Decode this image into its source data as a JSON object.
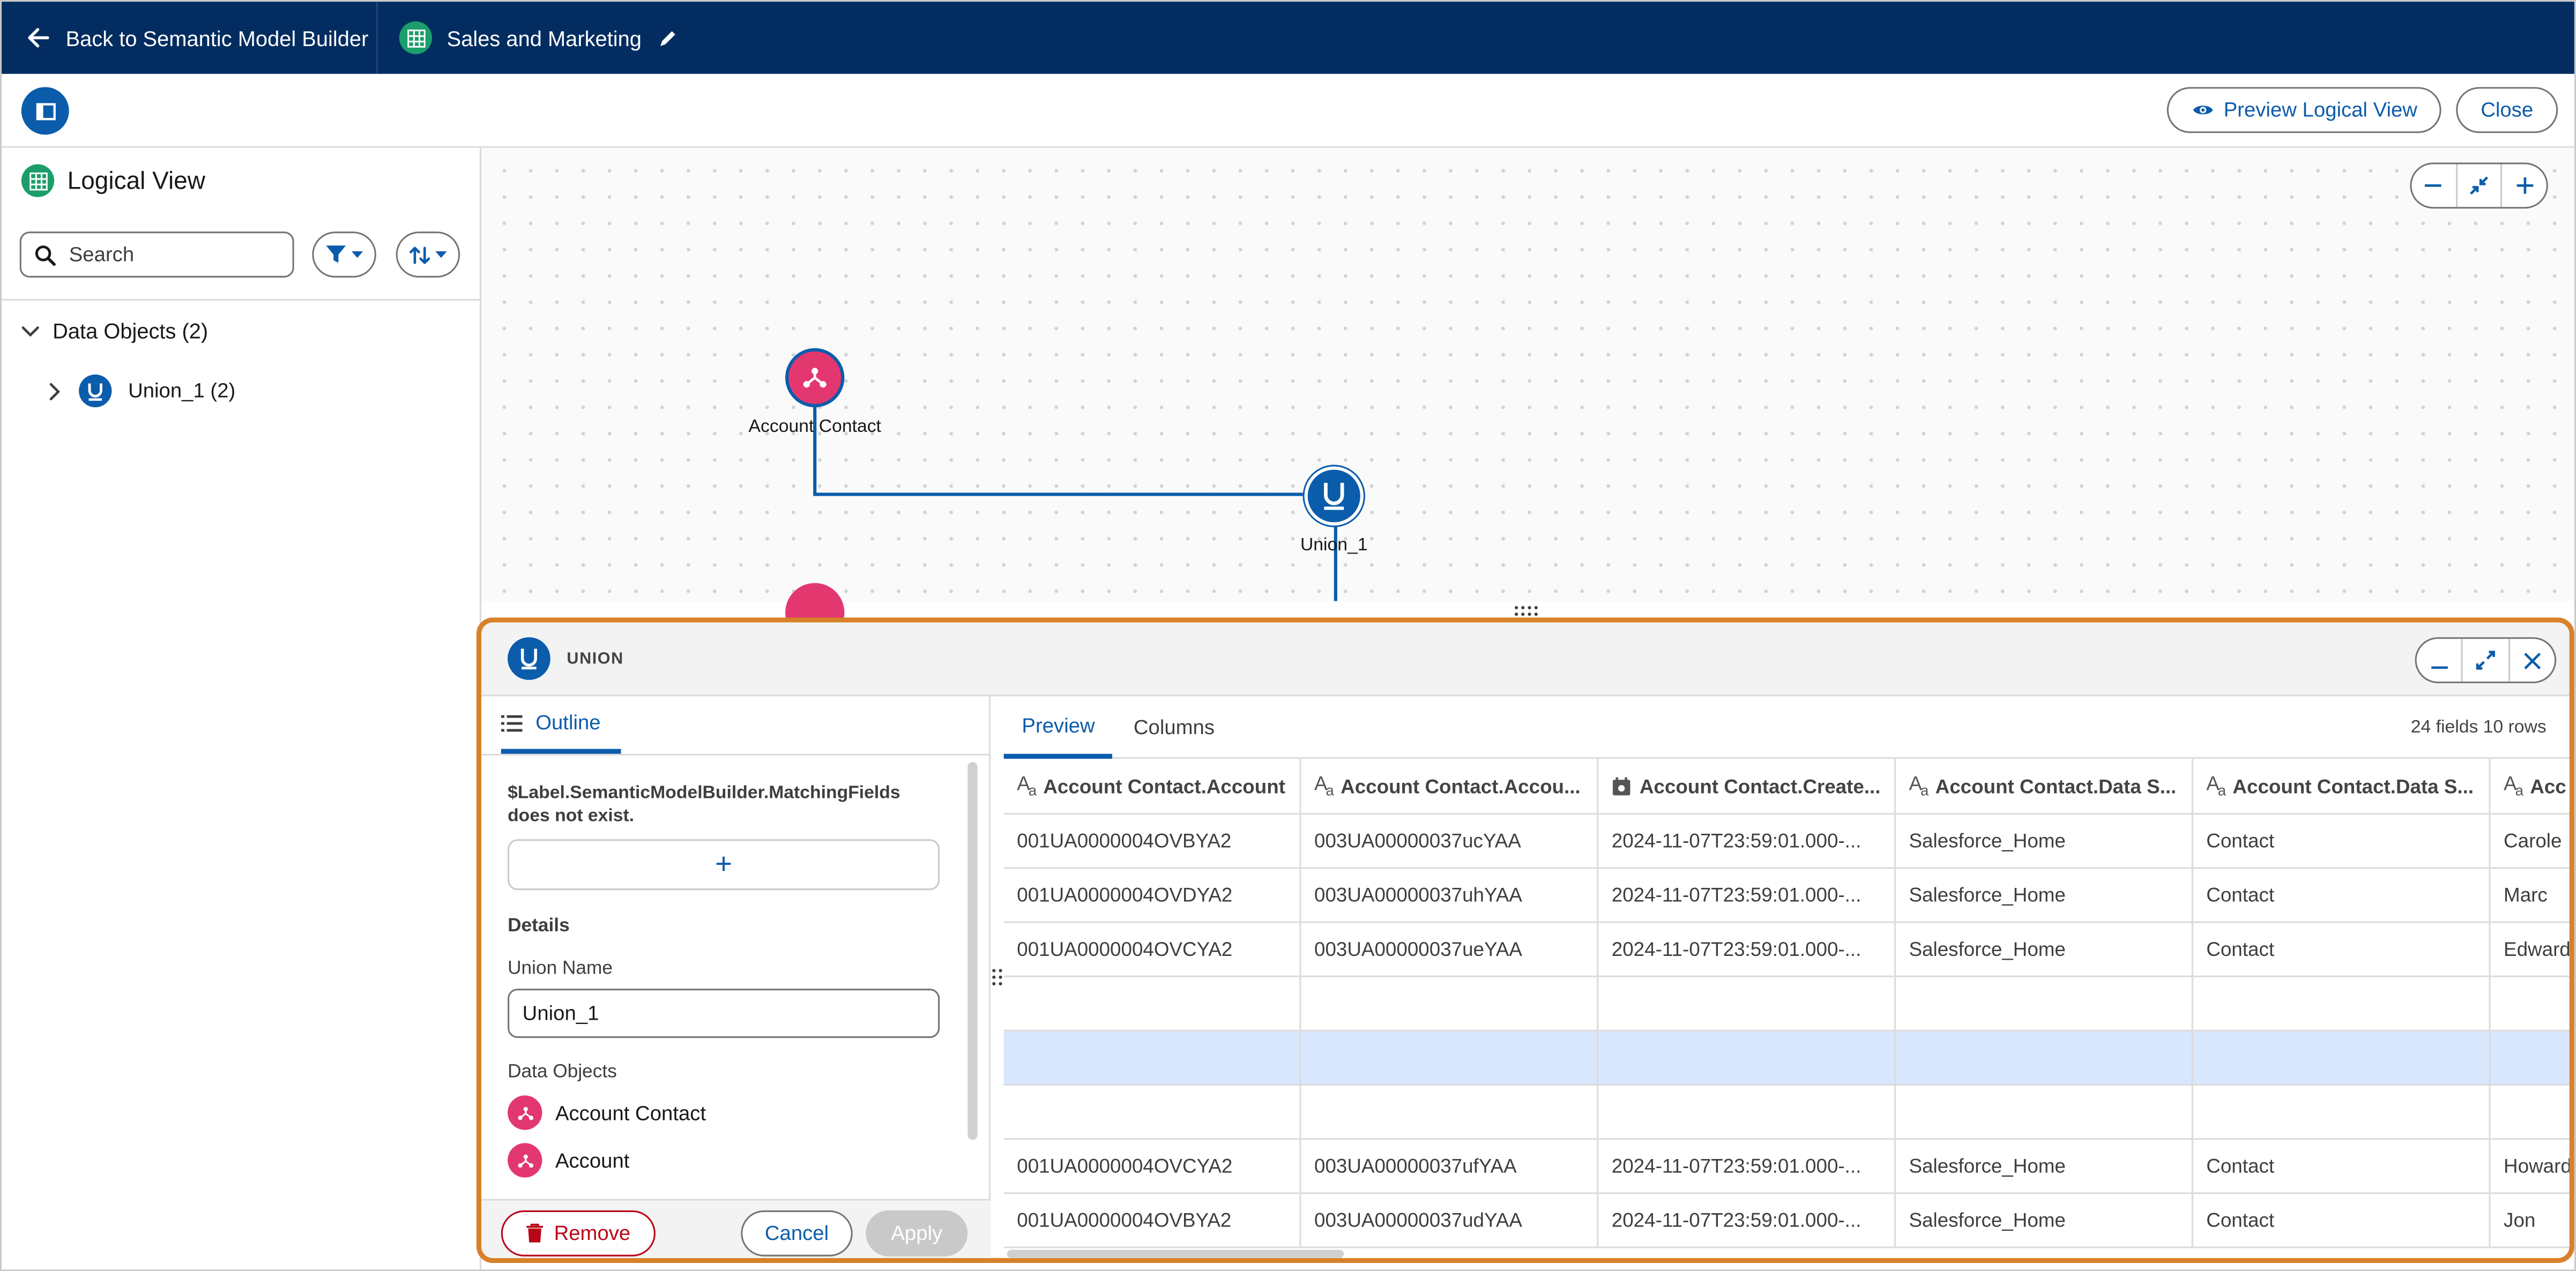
{
  "topnav": {
    "back_label": "Back to Semantic Model Builder",
    "model_name": "Sales and Marketing"
  },
  "toolbar": {
    "preview_label": "Preview Logical View",
    "close_label": "Close"
  },
  "left_panel": {
    "title": "Logical View",
    "search_placeholder": "Search",
    "tree": {
      "group_label": "Data Objects (2)",
      "item_label": "Union_1 (2)"
    }
  },
  "canvas": {
    "nodes": {
      "account_contact": "Account Contact",
      "union": "Union_1"
    }
  },
  "bottom_panel": {
    "title": "UNION",
    "outline": {
      "tab_label": "Outline",
      "warning": "$Label.SemanticModelBuilder.MatchingFields does not exist.",
      "add_symbol": "+",
      "details_label": "Details",
      "union_name_label": "Union Name",
      "union_name_value": "Union_1",
      "data_objects_label": "Data Objects",
      "data_objects": [
        "Account Contact",
        "Account"
      ],
      "remove_label": "Remove",
      "cancel_label": "Cancel",
      "apply_label": "Apply"
    },
    "preview": {
      "tabs": [
        "Preview",
        "Columns"
      ],
      "count": "24 fields 10 rows",
      "columns": [
        "Account Contact.Account",
        "Account Contact.Accou...",
        "Account Contact.Create...",
        "Account Contact.Data S...",
        "Account Contact.Data S...",
        "Acc"
      ],
      "rows": [
        [
          "001UA0000004OVBYA2",
          "003UA00000037ucYAA",
          "2024-11-07T23:59:01.000-...",
          "Salesforce_Home",
          "Contact",
          "Carole"
        ],
        [
          "001UA0000004OVDYA2",
          "003UA00000037uhYAA",
          "2024-11-07T23:59:01.000-...",
          "Salesforce_Home",
          "Contact",
          "Marc"
        ],
        [
          "001UA0000004OVCYA2",
          "003UA00000037ueYAA",
          "2024-11-07T23:59:01.000-...",
          "Salesforce_Home",
          "Contact",
          "Edward"
        ],
        [
          "",
          "",
          "",
          "",
          "",
          ""
        ],
        [
          "",
          "",
          "",
          "",
          "",
          ""
        ],
        [
          "",
          "",
          "",
          "",
          "",
          ""
        ],
        [
          "001UA0000004OVCYA2",
          "003UA00000037ufYAA",
          "2024-11-07T23:59:01.000-...",
          "Salesforce_Home",
          "Contact",
          "Howard"
        ],
        [
          "001UA0000004OVBYA2",
          "003UA00000037udYAA",
          "2024-11-07T23:59:01.000-...",
          "Salesforce_Home",
          "Contact",
          "Jon"
        ]
      ]
    }
  },
  "colors": {
    "nav_bg": "#032d60",
    "brand_blue": "#0b5cab",
    "object_pink": "#e3386f",
    "highlight_orange": "#d8812a",
    "selected_row": "#d8e6fe",
    "remove_red": "#ba0517"
  }
}
